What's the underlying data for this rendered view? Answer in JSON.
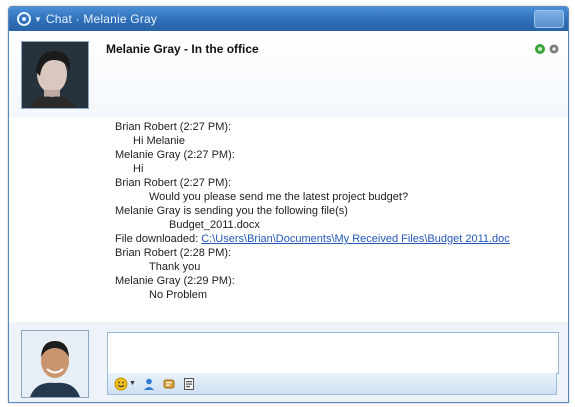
{
  "window": {
    "title": "Chat · Melanie Gray",
    "app_icon": "communicator-icon"
  },
  "header": {
    "contact_name": "Melanie Gray - In the office",
    "icons": [
      "presence-icon",
      "gear-icon"
    ]
  },
  "conversation": {
    "messages": [
      {
        "sender": "Brian Robert (2:27 PM):",
        "text": "Hi Melanie"
      },
      {
        "sender": "Melanie Gray (2:27 PM):",
        "text": "Hi"
      },
      {
        "sender": "Brian Robert (2:27 PM):",
        "text": "Would you please send me the latest project budget?"
      }
    ],
    "file_send_notice": "Melanie Gray is sending you the following file(s)",
    "file_name": "Budget_2011.docx",
    "download_label": "File downloaded:",
    "download_path": "C:\\Users\\Brian\\Documents\\My Received Files\\Budget 2011.doc",
    "messages_after": [
      {
        "sender": "Brian Robert (2:28 PM):",
        "text": "Thank you"
      },
      {
        "sender": "Melanie Gray (2:29 PM):",
        "text": "No Problem"
      }
    ]
  },
  "compose": {
    "input_value": "",
    "toolbar": [
      "emoticon-icon",
      "contact-icon",
      "status-icon",
      "attachment-icon"
    ]
  }
}
